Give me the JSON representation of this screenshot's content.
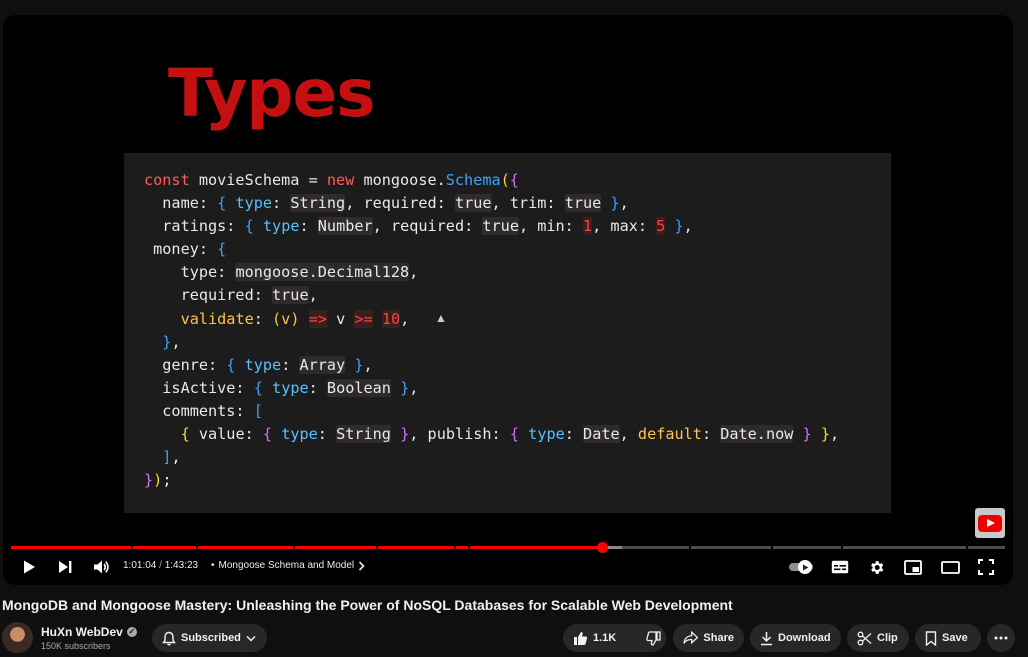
{
  "slide": {
    "title": "Types",
    "code_lines": [
      "const movieSchema = new mongoose.Schema({",
      "  name: { type: String, required: true, trim: true },",
      "  ratings: { type: Number, required: true, min: 1, max: 5 },",
      " money: {",
      "    type: mongoose.Decimal128,",
      "    required: true,",
      "    validate: (v) => v >= 10,",
      "  },",
      "  genre: { type: Array },",
      "  isActive: { type: Boolean },",
      "  comments: [",
      "    { value: { type: String }, publish: { type: Date, default: Date.now } },",
      "  ],",
      "});"
    ]
  },
  "player": {
    "progress": {
      "played_fraction": 0.595,
      "buffered_fraction": 0.615
    },
    "current_time": "1:01:04",
    "separator": "/",
    "duration": "1:43:23",
    "dot": "•",
    "chapter": "Mongoose Schema and Model",
    "icons": {
      "play": "play-icon",
      "next": "next-icon",
      "volume": "volume-icon",
      "autoplay": "autoplay-toggle",
      "captions": "captions-icon",
      "settings": "settings-icon",
      "miniplayer": "miniplayer-icon",
      "theater": "theater-icon",
      "fullscreen": "fullscreen-icon"
    },
    "brand_color": "#ff0000"
  },
  "video": {
    "title": "MongoDB and Mongoose Mastery: Unleashing the Power of NoSQL Databases for Scalable Web Development",
    "channel_name": "HuXn WebDev",
    "verified_mark": "✓",
    "subscribers": "150K subscribers",
    "subscribe_label": "Subscribed",
    "like_count": "1.1K",
    "share_label": "Share",
    "download_label": "Download",
    "clip_label": "Clip",
    "save_label": "Save"
  }
}
